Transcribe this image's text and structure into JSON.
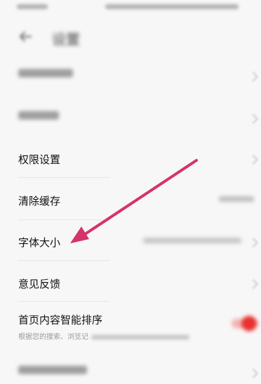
{
  "header": {
    "title": "设置"
  },
  "settings": {
    "item1": {
      "label": "",
      "value": ""
    },
    "item2": {
      "label": ""
    },
    "permissions": {
      "label": "权限设置"
    },
    "clear_cache": {
      "label": "清除缓存",
      "value": ""
    },
    "font_size": {
      "label": "字体大小",
      "value": ""
    },
    "feedback": {
      "label": "意见反馈"
    },
    "smart_sort": {
      "label": "首页内容智能排序",
      "sublabel_visible": "根据您的搜索、浏览记",
      "enabled": true
    },
    "item_last": {
      "label": ""
    }
  },
  "colors": {
    "arrow": "#d6336c",
    "toggle_on": "#e8322f",
    "background": "#f7f7f7"
  },
  "icons": {
    "back": "arrow-left-icon",
    "chevron": "chevron-right-icon"
  }
}
